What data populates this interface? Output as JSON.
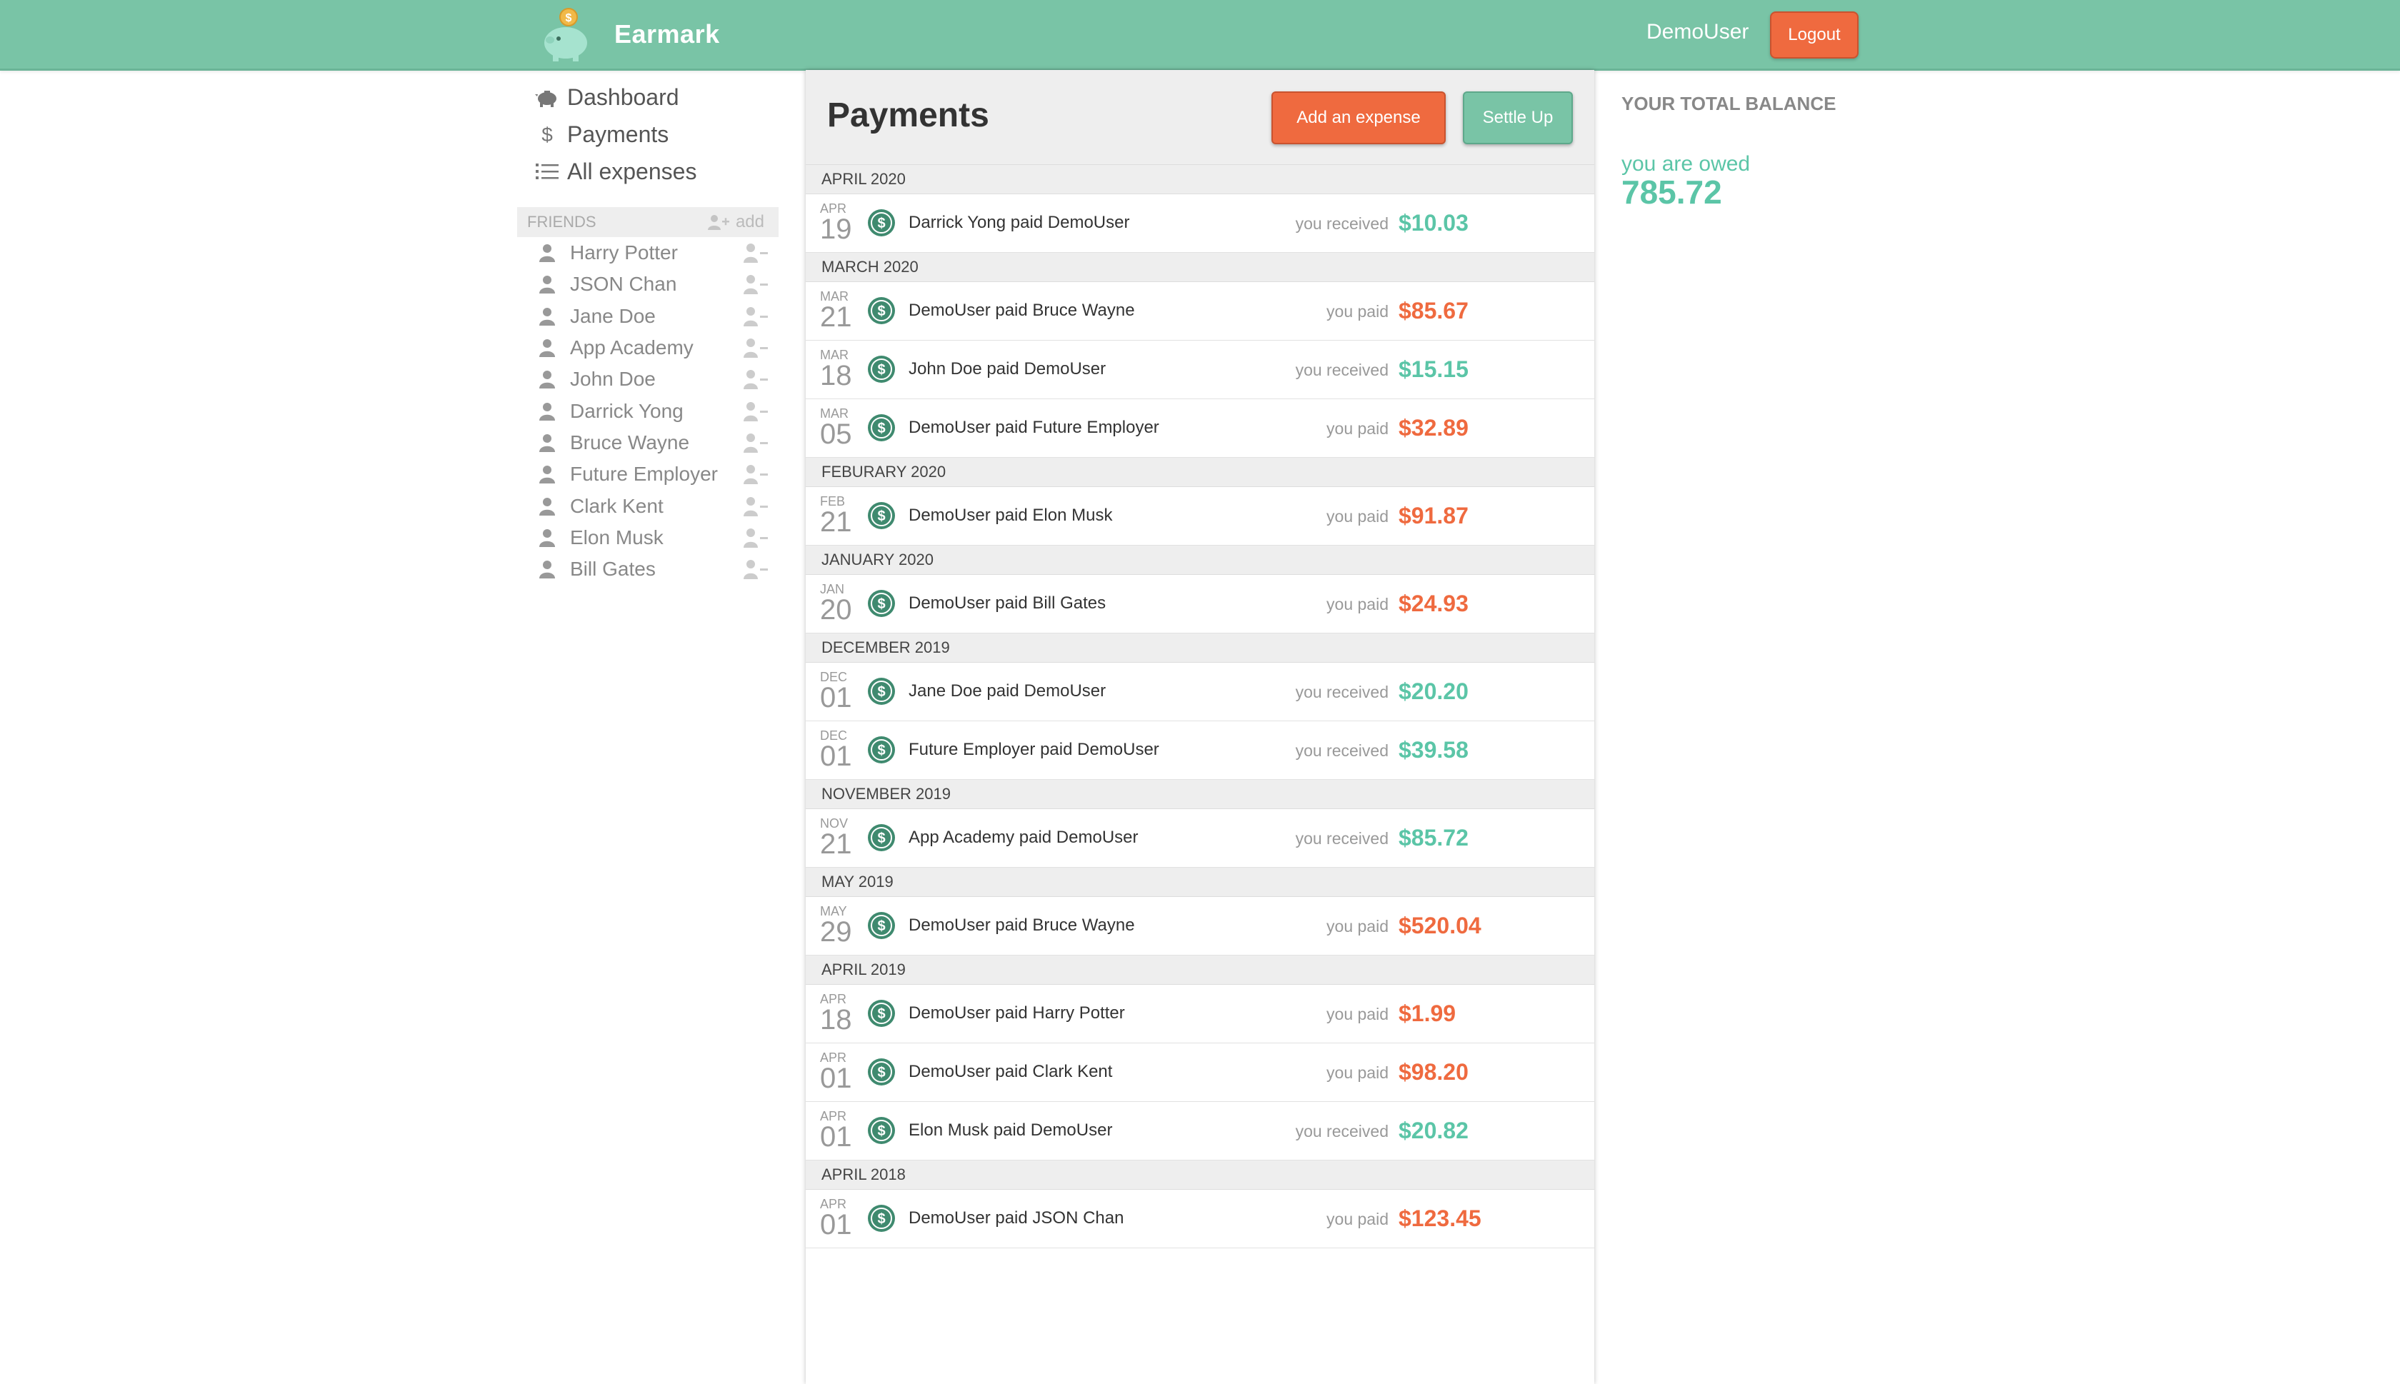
{
  "app": {
    "name": "Earmark",
    "user_name": "DemoUser",
    "logout_label": "Logout",
    "colors": {
      "brand": "#79c4a6",
      "accent": "#ef6a3f",
      "owed": "#5bc5a7"
    }
  },
  "sidebar": {
    "nav": [
      {
        "label": "Dashboard",
        "icon": "piggy-bank-icon"
      },
      {
        "label": "Payments",
        "icon": "dollar-icon"
      },
      {
        "label": "All expenses",
        "icon": "list-icon"
      }
    ],
    "friends_header": "FRIENDS",
    "friends_add_label": "add",
    "friends": [
      "Harry Potter",
      "JSON Chan",
      "Jane Doe",
      "App Academy",
      "John Doe",
      "Darrick Yong",
      "Bruce Wayne",
      "Future Employer",
      "Clark Kent",
      "Elon Musk",
      "Bill Gates"
    ]
  },
  "main": {
    "title": "Payments",
    "add_expense_label": "Add an expense",
    "settle_up_label": "Settle Up",
    "groups": [
      {
        "month": "APRIL 2020",
        "rows": [
          {
            "mon": "APR",
            "day": "19",
            "desc": "Darrick Yong paid DemoUser",
            "dir": "you received",
            "amount": "$10.03",
            "kind": "received"
          }
        ]
      },
      {
        "month": "MARCH 2020",
        "rows": [
          {
            "mon": "MAR",
            "day": "21",
            "desc": "DemoUser paid Bruce Wayne",
            "dir": "you paid",
            "amount": "$85.67",
            "kind": "paid"
          },
          {
            "mon": "MAR",
            "day": "18",
            "desc": "John Doe paid DemoUser",
            "dir": "you received",
            "amount": "$15.15",
            "kind": "received"
          },
          {
            "mon": "MAR",
            "day": "05",
            "desc": "DemoUser paid Future Employer",
            "dir": "you paid",
            "amount": "$32.89",
            "kind": "paid"
          }
        ]
      },
      {
        "month": "FEBURARY 2020",
        "rows": [
          {
            "mon": "FEB",
            "day": "21",
            "desc": "DemoUser paid Elon Musk",
            "dir": "you paid",
            "amount": "$91.87",
            "kind": "paid"
          }
        ]
      },
      {
        "month": "JANUARY 2020",
        "rows": [
          {
            "mon": "JAN",
            "day": "20",
            "desc": "DemoUser paid Bill Gates",
            "dir": "you paid",
            "amount": "$24.93",
            "kind": "paid"
          }
        ]
      },
      {
        "month": "DECEMBER 2019",
        "rows": [
          {
            "mon": "DEC",
            "day": "01",
            "desc": "Jane Doe paid DemoUser",
            "dir": "you received",
            "amount": "$20.20",
            "kind": "received"
          },
          {
            "mon": "DEC",
            "day": "01",
            "desc": "Future Employer paid DemoUser",
            "dir": "you received",
            "amount": "$39.58",
            "kind": "received"
          }
        ]
      },
      {
        "month": "NOVEMBER 2019",
        "rows": [
          {
            "mon": "NOV",
            "day": "21",
            "desc": "App Academy paid DemoUser",
            "dir": "you received",
            "amount": "$85.72",
            "kind": "received"
          }
        ]
      },
      {
        "month": "MAY 2019",
        "rows": [
          {
            "mon": "MAY",
            "day": "29",
            "desc": "DemoUser paid Bruce Wayne",
            "dir": "you paid",
            "amount": "$520.04",
            "kind": "paid"
          }
        ]
      },
      {
        "month": "APRIL 2019",
        "rows": [
          {
            "mon": "APR",
            "day": "18",
            "desc": "DemoUser paid Harry Potter",
            "dir": "you paid",
            "amount": "$1.99",
            "kind": "paid"
          },
          {
            "mon": "APR",
            "day": "01",
            "desc": "DemoUser paid Clark Kent",
            "dir": "you paid",
            "amount": "$98.20",
            "kind": "paid"
          },
          {
            "mon": "APR",
            "day": "01",
            "desc": "Elon Musk paid DemoUser",
            "dir": "you received",
            "amount": "$20.82",
            "kind": "received"
          }
        ]
      },
      {
        "month": "APRIL 2018",
        "rows": [
          {
            "mon": "APR",
            "day": "01",
            "desc": "DemoUser paid JSON Chan",
            "dir": "you paid",
            "amount": "$123.45",
            "kind": "paid"
          }
        ]
      }
    ]
  },
  "balance": {
    "title": "YOUR TOTAL BALANCE",
    "label": "you are owed",
    "value": "785.72"
  }
}
